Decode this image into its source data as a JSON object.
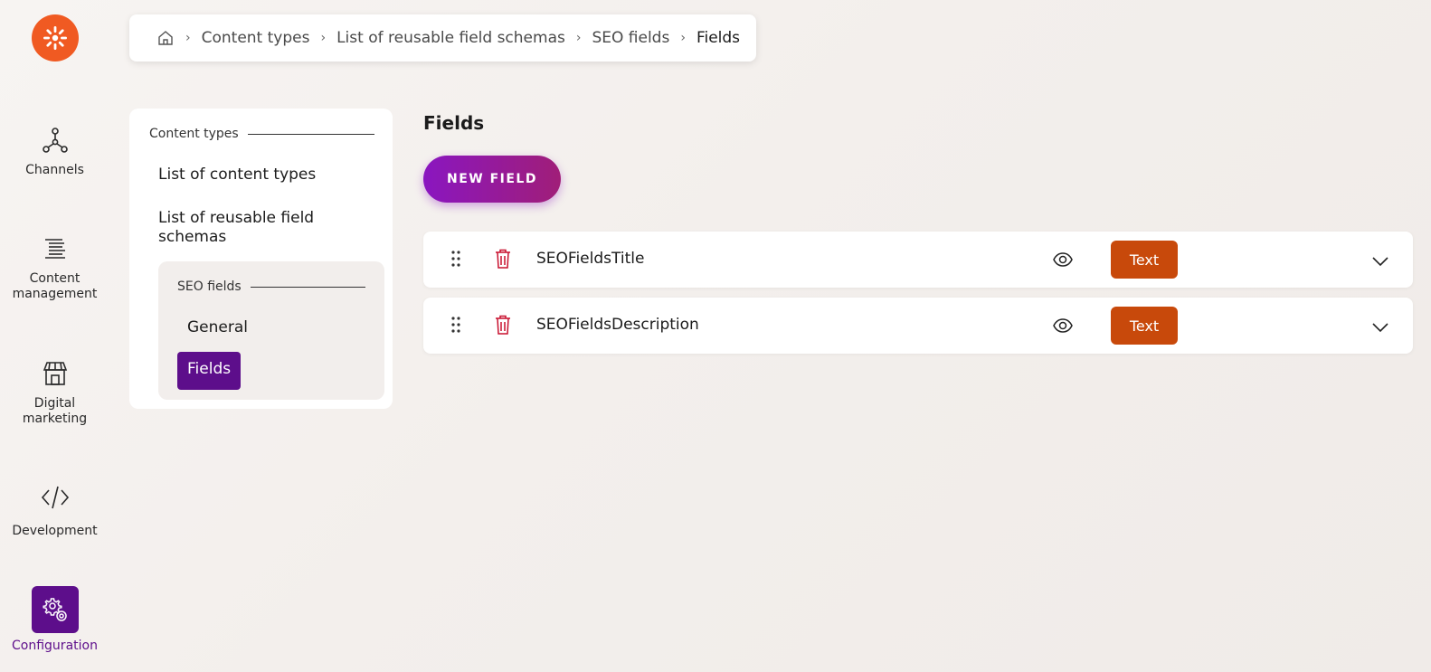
{
  "rail": {
    "items": [
      {
        "label": "Channels"
      },
      {
        "label": "Content management"
      },
      {
        "label": "Digital marketing"
      },
      {
        "label": "Development"
      },
      {
        "label": "Configuration"
      }
    ]
  },
  "breadcrumb": {
    "items": [
      "Content types",
      "List of reusable field schemas",
      "SEO fields",
      "Fields"
    ]
  },
  "subnav": {
    "section_title": "Content types",
    "links": [
      "List of content types",
      "List of reusable field schemas"
    ],
    "nested": {
      "section_title": "SEO fields",
      "items": [
        "General",
        "Fields"
      ],
      "active": "Fields"
    }
  },
  "main": {
    "title": "Fields",
    "new_field_label": "NEW FIELD",
    "fields": [
      {
        "name": "SEOFieldsTitle",
        "type": "Text"
      },
      {
        "name": "SEOFieldsDescription",
        "type": "Text"
      }
    ]
  },
  "colors": {
    "accent": "#5d0e8b",
    "logo": "#f05a22",
    "badge": "#c8490b",
    "delete": "#c8102e"
  }
}
